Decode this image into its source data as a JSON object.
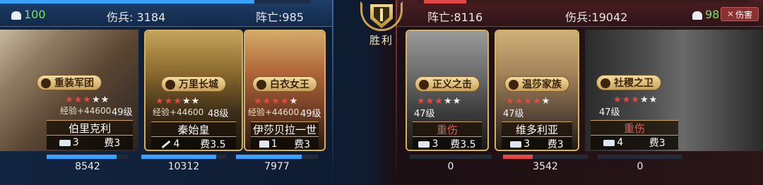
{
  "result": {
    "label": "胜利"
  },
  "left": {
    "morale": "100",
    "wounded_label": "伤兵:",
    "wounded": "3184",
    "killed_label": "阵亡:",
    "killed": "985",
    "heroes": [
      {
        "name": "伯里克利",
        "corps": "重装军团",
        "stars_red": 3,
        "stars_total": 5,
        "exp": "经验+44600",
        "level": "49级",
        "troops": "3",
        "cost": "费3",
        "troop_icon": "tank-icon",
        "hp": "8542",
        "hp_ratio": 0.85
      },
      {
        "name": "秦始皇",
        "corps": "万里长城",
        "stars_red": 3,
        "stars_total": 5,
        "exp": "经验+44600",
        "level": "48级",
        "troops": "4",
        "cost": "费3.5",
        "troop_icon": "gun-icon",
        "hp": "10312",
        "hp_ratio": 0.88
      },
      {
        "name": "伊莎贝拉一世",
        "corps": "白衣女王",
        "stars_red": 4,
        "stars_total": 5,
        "exp": "经验+44600",
        "level": "49级",
        "troops": "1",
        "cost": "费3",
        "troop_icon": "cavalry-icon",
        "hp": "7977",
        "hp_ratio": 0.8
      }
    ]
  },
  "right": {
    "killed_label": "阵亡:",
    "killed": "8116",
    "wounded_label": "伤兵:",
    "wounded": "19042",
    "morale": "98",
    "damage_button": "伤害",
    "heroes": [
      {
        "name": "重伤",
        "status": "bad",
        "corps": "正义之击",
        "stars_red": 3,
        "stars_total": 5,
        "level": "47级",
        "troops": "3",
        "cost": "费3.5",
        "troop_icon": "tank-icon",
        "hp": "0",
        "hp_ratio": 0.0
      },
      {
        "name": "维多利亚",
        "status": "ok",
        "corps": "温莎家族",
        "stars_red": 4,
        "stars_total": 5,
        "level": "47级",
        "troops": "3",
        "cost": "费3",
        "troop_icon": "tank-icon",
        "hp": "3542",
        "hp_ratio": 0.35
      },
      {
        "name": "重伤",
        "status": "bad",
        "corps": "社稷之卫",
        "stars_red": 3,
        "stars_total": 5,
        "level": "47级",
        "troops": "4",
        "cost": "费3",
        "troop_icon": "tank-icon",
        "hp": "0",
        "hp_ratio": 0.0
      }
    ]
  },
  "colors": {
    "left_accent": "#3ba2ff",
    "right_accent": "#e04848",
    "gold": "#d7b05a",
    "injured_text": "#ff5040"
  }
}
